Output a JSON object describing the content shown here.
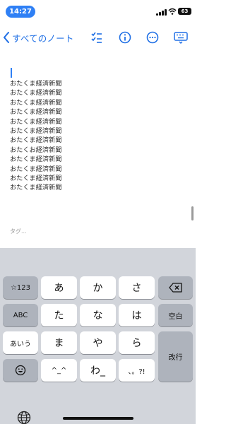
{
  "status_bar": {
    "time": "14:27",
    "battery": "63"
  },
  "nav": {
    "back_label": "すべてのノート",
    "icons": [
      "checklist-icon",
      "info-icon",
      "more-icon",
      "keyboard-icon"
    ]
  },
  "note": {
    "lines": [
      "おたくま経済新聞",
      "おたくま経済新聞",
      "おたくま経済新聞",
      "おたくま経済新聞",
      "おたくま経済新聞",
      "おたくま経済新聞",
      "おたくま経済新聞",
      "おたくお経済新聞",
      "おたくま経済新聞",
      "おたくま経済新聞",
      "おたくま経済新聞",
      "おたくま経済新聞"
    ],
    "tags_placeholder": "タグ..."
  },
  "keyboard": {
    "left_column": [
      "☆123",
      "ABC",
      "あいう"
    ],
    "rows": [
      [
        "あ",
        "か",
        "さ"
      ],
      [
        "た",
        "な",
        "は"
      ],
      [
        "ま",
        "や",
        "ら"
      ],
      [
        "^_^",
        "わ_",
        "、。?!"
      ]
    ],
    "space_label": "空白",
    "return_label": "改行"
  }
}
